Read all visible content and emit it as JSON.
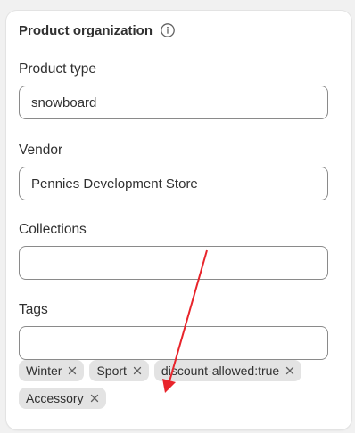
{
  "card": {
    "title": "Product organization",
    "info_icon": "info-icon"
  },
  "fields": {
    "product_type": {
      "label": "Product type",
      "value": "snowboard"
    },
    "vendor": {
      "label": "Vendor",
      "value": "Pennies Development Store"
    },
    "collections": {
      "label": "Collections",
      "value": ""
    },
    "tags": {
      "label": "Tags",
      "value": ""
    }
  },
  "tags": [
    "Winter",
    "Sport",
    "discount-allowed:true",
    "Accessory"
  ],
  "annotation": {
    "arrow_color": "#e8242b"
  }
}
